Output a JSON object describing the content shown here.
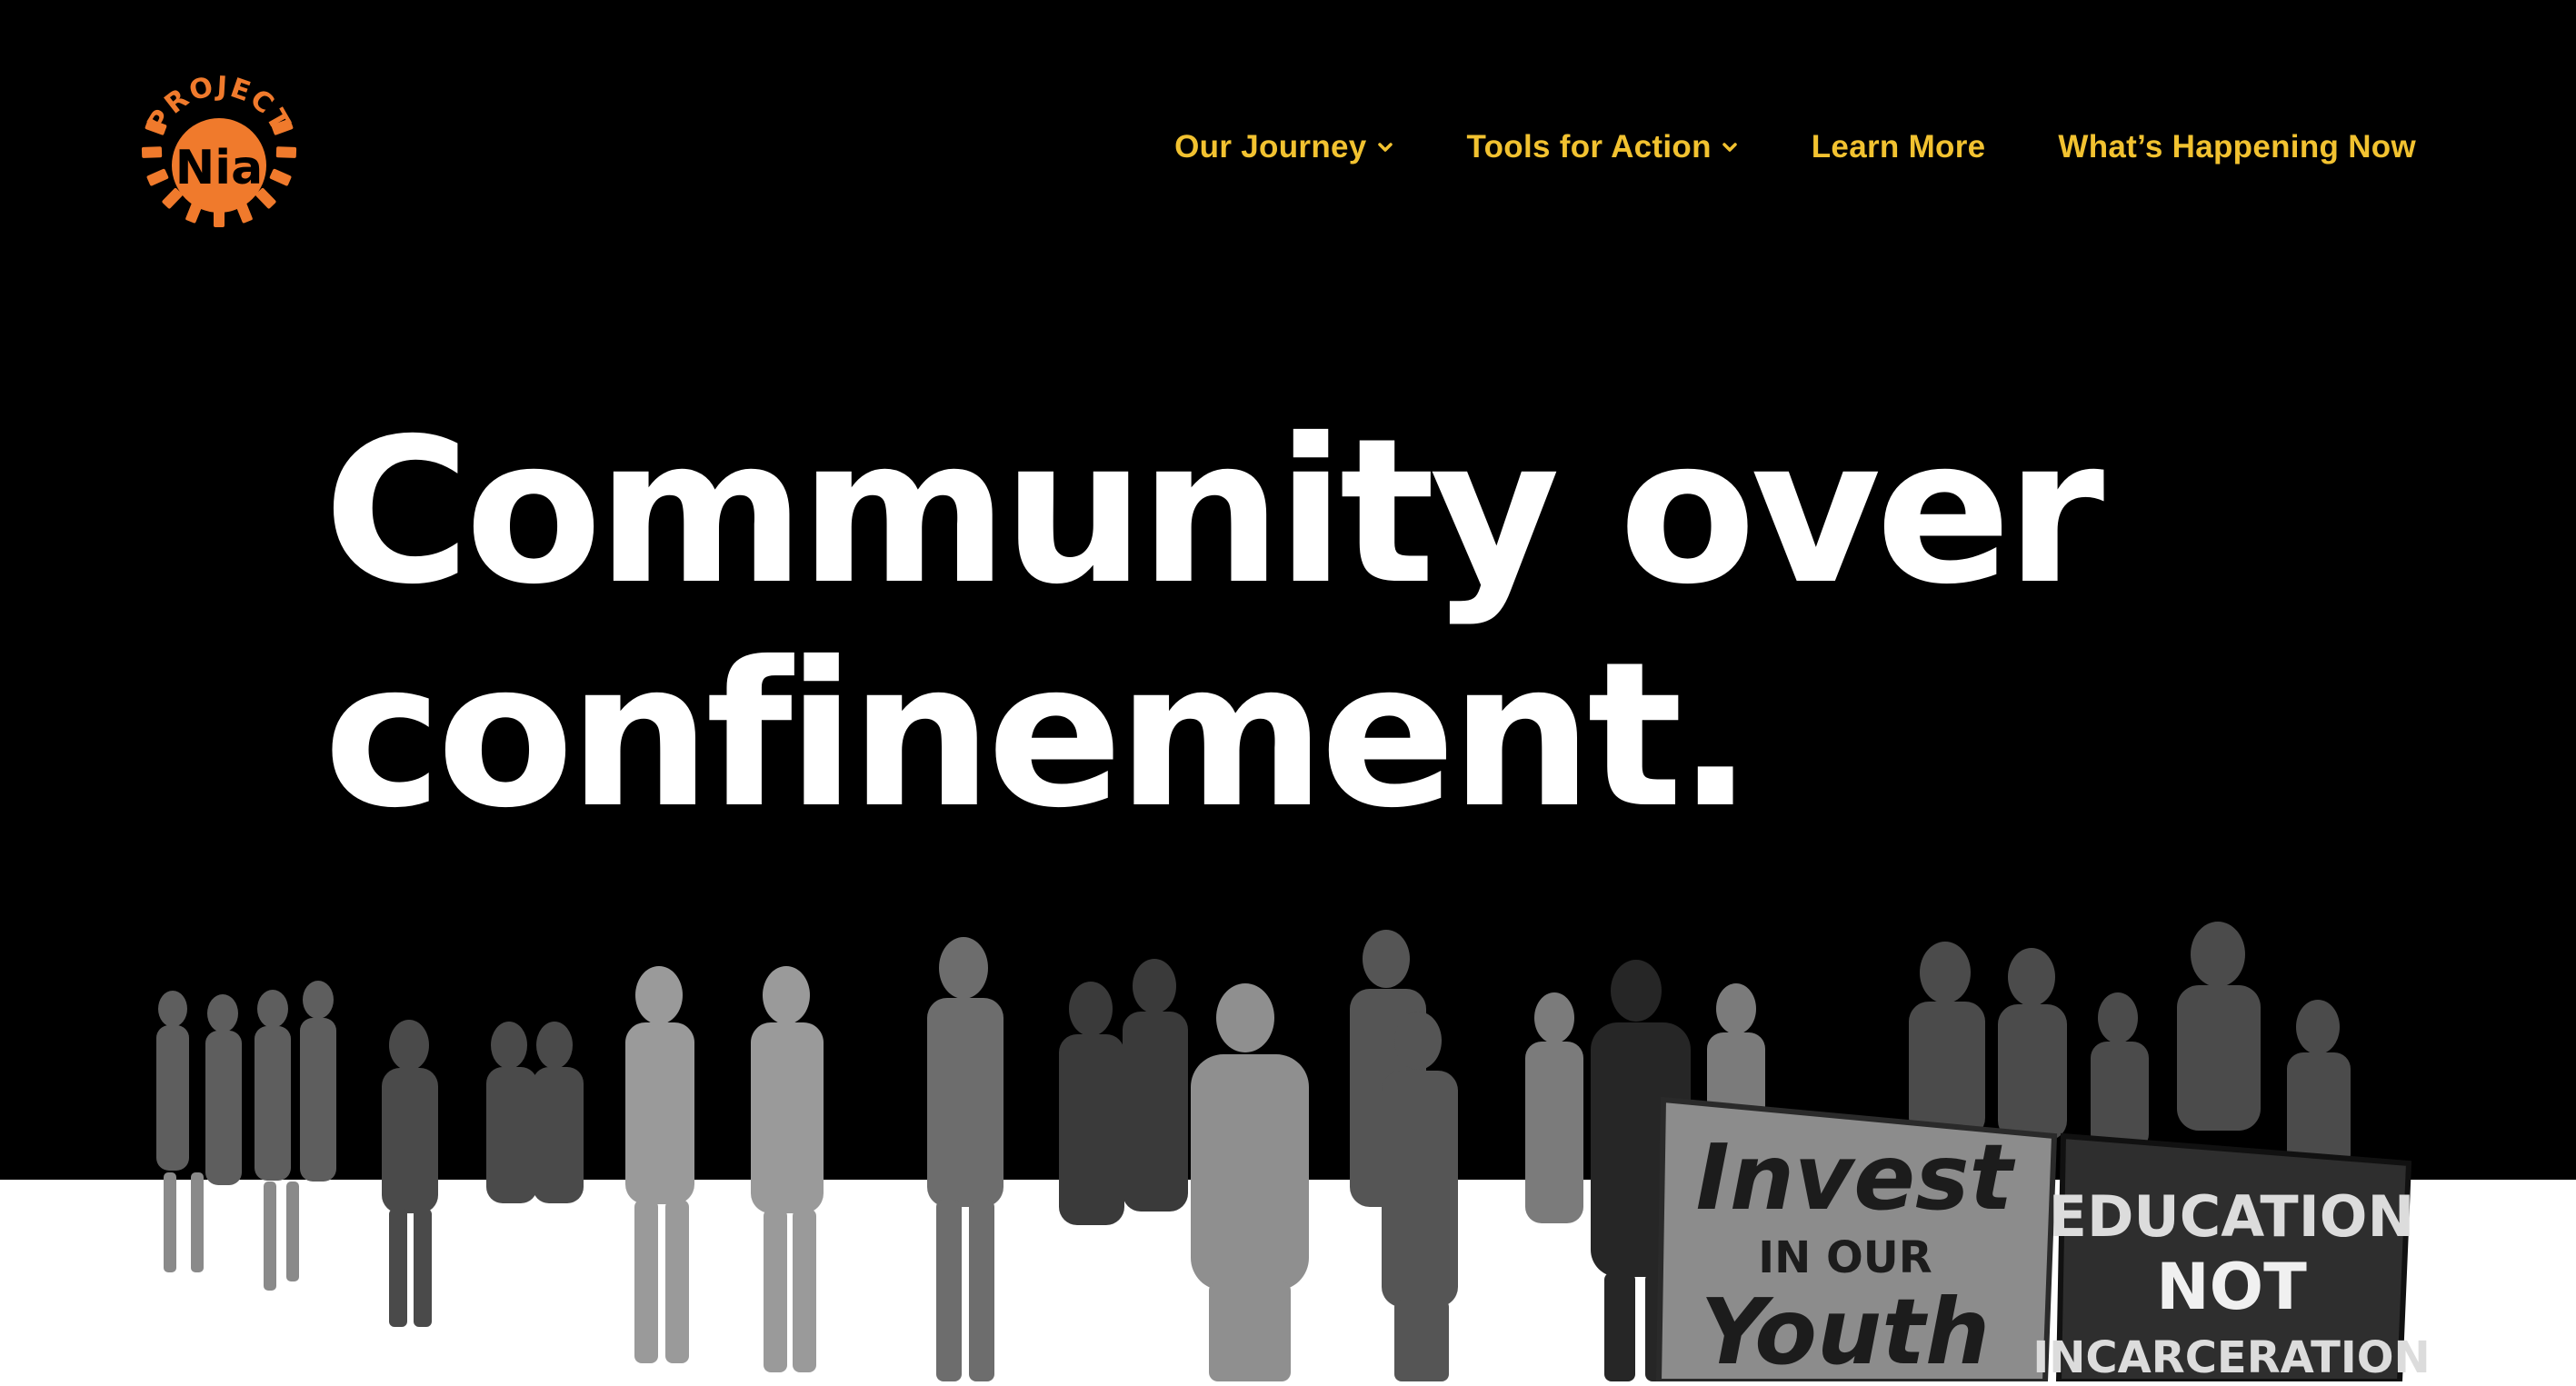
{
  "brand": {
    "logo_top_text": "PROJECT",
    "logo_mark_text": "Nia",
    "accent_color": "#f07a2c"
  },
  "nav": {
    "items": [
      {
        "label": "Our Journey",
        "has_dropdown": true
      },
      {
        "label": "Tools for Action",
        "has_dropdown": true
      },
      {
        "label": "Learn More",
        "has_dropdown": false
      },
      {
        "label": "What’s Happening Now",
        "has_dropdown": false
      }
    ],
    "color": "#f2c230"
  },
  "hero": {
    "headline_line1": "Community over",
    "headline_line2": "confinement."
  },
  "photo": {
    "banner_left_line1": "Invest",
    "banner_left_line2": "IN OUR",
    "banner_left_line3": "Youth",
    "banner_right_line1": "EDUCATION",
    "banner_right_line2": "NOT",
    "banner_right_line3": "INCARCERATION"
  }
}
